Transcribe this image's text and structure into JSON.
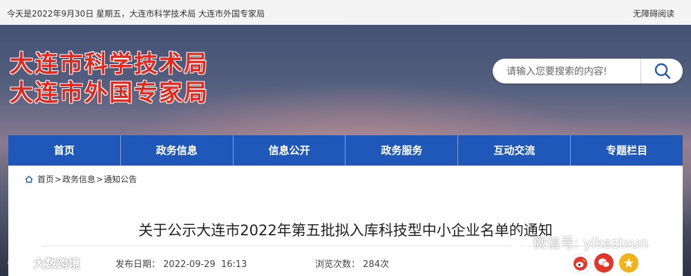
{
  "topbar": {
    "date_text": "今天是2022年9月30日 星期五，大连市科学技术局 大连市外国专家局",
    "accessibility_link": "无障碍阅读"
  },
  "site": {
    "title_line1": "大连市科学技术局",
    "title_line2": "大连市外国专家局",
    "title_color": "#e02a1f"
  },
  "search": {
    "placeholder": "请输入您要搜索的内容!",
    "icon": "search-icon"
  },
  "nav": {
    "color": "#1f58b8",
    "items": [
      "首页",
      "政务信息",
      "信息公开",
      "政务服务",
      "互动交流",
      "专题栏目"
    ]
  },
  "breadcrumb": {
    "icon": "home-icon",
    "items": [
      "首页",
      "政务信息",
      "通知公告"
    ],
    "separator": ">"
  },
  "article": {
    "title": "关于公示大连市2022年第五批拟入库科技型中小企业名单的通知",
    "publish_label": "发布日期：",
    "publish_date": "2022-09-29  16:13",
    "views_label": "浏览次数：",
    "views": "284次"
  },
  "share": {
    "icons": [
      "weibo-icon",
      "wechat-icon",
      "favorite-star-icon"
    ],
    "colors": [
      "#e2352b",
      "#e2352b",
      "#f0b21d"
    ]
  },
  "watermarks": {
    "wechat_text": "微信号: yikezixun",
    "brand_text": "大数跨境"
  }
}
